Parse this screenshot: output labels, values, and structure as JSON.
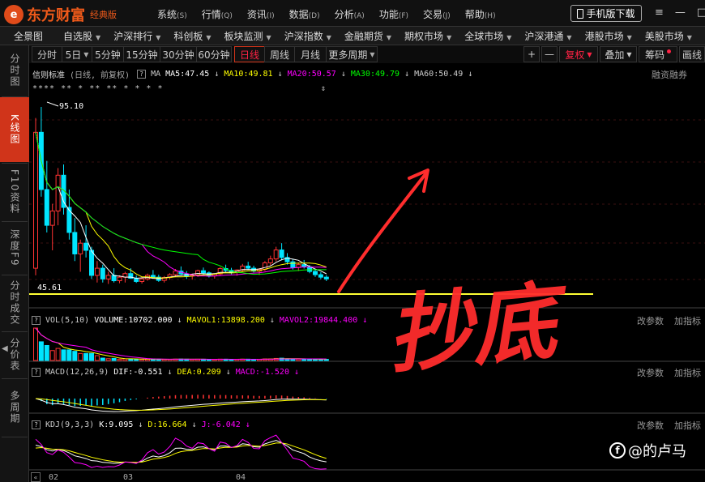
{
  "app": {
    "logo_mark": "e",
    "name": "东方财富",
    "edition": "经典版"
  },
  "main_menu": [
    {
      "label": "系统",
      "key": "S"
    },
    {
      "label": "行情",
      "key": "Q"
    },
    {
      "label": "资讯",
      "key": "I"
    },
    {
      "label": "数据",
      "key": "D"
    },
    {
      "label": "分析",
      "key": "A"
    },
    {
      "label": "功能",
      "key": "F"
    },
    {
      "label": "交易",
      "key": "J"
    },
    {
      "label": "帮助",
      "key": "H"
    }
  ],
  "mobile_download": "手机版下载",
  "subnav": [
    "全景图",
    "自选股",
    "沪深排行",
    "科创板",
    "板块监测",
    "沪深指数",
    "金融期货",
    "期权市场",
    "全球市场",
    "沪深港通",
    "港股市场",
    "美股市场"
  ],
  "left_tabs": [
    {
      "label": "分时图",
      "active": false
    },
    {
      "label": "K线图",
      "active": true
    },
    {
      "label": "F10资料",
      "active": false
    },
    {
      "label": "深度F9",
      "active": false
    },
    {
      "label": "分时成交",
      "active": false
    },
    {
      "label": "分价表",
      "active": false
    },
    {
      "label": "多周期",
      "active": false
    }
  ],
  "period_tabs": [
    {
      "label": "分时",
      "active": false,
      "dropdown": false
    },
    {
      "label": "5日",
      "active": false,
      "dropdown": true
    },
    {
      "label": "5分钟",
      "active": false,
      "dropdown": false
    },
    {
      "label": "15分钟",
      "active": false,
      "dropdown": false
    },
    {
      "label": "30分钟",
      "active": false,
      "dropdown": false
    },
    {
      "label": "60分钟",
      "active": false,
      "dropdown": false
    },
    {
      "label": "日线",
      "active": true,
      "dropdown": false
    },
    {
      "label": "周线",
      "active": false,
      "dropdown": false
    },
    {
      "label": "月线",
      "active": false,
      "dropdown": false
    },
    {
      "label": "更多周期",
      "active": false,
      "dropdown": true
    }
  ],
  "toolbar_right": {
    "zoom_in": "+",
    "zoom_out": "—",
    "fuquan": "复权",
    "overlay": "叠加",
    "chip": "筹码",
    "draw": "画线"
  },
  "main_indicator": {
    "name": "信则标准",
    "mode": "(日线, 前复权)",
    "type": "MA",
    "ma5": "MA5:47.45",
    "ma10": "MA10:49.81",
    "ma20": "MA20:50.57",
    "ma30": "MA30:49.79",
    "ma60": "MA60:50.49",
    "right_link": "融资融券",
    "event_markers": "**** ** *  **     ** *  *  *       *",
    "high_label": "95.10",
    "low_label": "45.61",
    "colors": {
      "ma5": "#ffffff",
      "ma10": "#ffff00",
      "ma20": "#ff00ff",
      "ma30": "#00ff00",
      "ma60": "#cccccc",
      "up": "#ff3333",
      "down": "#00e5ff",
      "support_line": "#ffff33"
    }
  },
  "volume_indicator": {
    "name": "VOL(5,10)",
    "volume": "VOLUME:10702.000",
    "mavol1": "MAVOL1:13898.200",
    "mavol2": "MAVOL2:19844.400"
  },
  "macd_indicator": {
    "name": "MACD(12,26,9)",
    "dif": "DIF:-0.551",
    "dea": "DEA:0.209",
    "macd": "MACD:-1.520"
  },
  "kdj_indicator": {
    "name": "KDJ(9,3,3)",
    "k": "K:9.095",
    "d": "D:16.664",
    "j": "J:-6.042"
  },
  "panel_links": {
    "params": "改参数",
    "add_indicator": "加指标"
  },
  "x_axis": [
    "02",
    "03",
    "04"
  ],
  "annotation": {
    "text": "抄底",
    "color": "#ff2d2d"
  },
  "brand": {
    "icon": "f",
    "name": "@的卢马"
  },
  "chart_data": [
    {
      "type": "candlestick",
      "title": "信则标准 (日线, 前复权)",
      "max_label": 95.1,
      "min_label": 45.61,
      "note": "daily K-line: price spikes to 95.10 then trends down, consolidates near 45.61 support",
      "ohlc": [
        [
          50,
          92,
          48,
          88
        ],
        [
          88,
          95.1,
          70,
          72
        ],
        [
          72,
          80,
          60,
          62
        ],
        [
          62,
          68,
          55,
          66
        ],
        [
          66,
          78,
          62,
          76
        ],
        [
          76,
          79,
          65,
          67
        ],
        [
          67,
          72,
          58,
          60
        ],
        [
          60,
          64,
          52,
          54
        ],
        [
          54,
          58,
          49,
          57
        ],
        [
          57,
          62,
          53,
          55
        ],
        [
          55,
          56,
          47,
          48
        ],
        [
          48,
          52,
          46,
          50
        ],
        [
          50,
          51,
          46,
          47
        ],
        [
          47,
          49,
          45.6,
          48
        ],
        [
          48,
          50,
          46,
          46.5
        ],
        [
          46.5,
          48,
          45.8,
          47.5
        ],
        [
          47.5,
          49,
          46,
          48.5
        ],
        [
          48.5,
          50,
          47,
          47.2
        ],
        [
          47.2,
          48,
          45.9,
          46.3
        ],
        [
          46.3,
          47.5,
          45.7,
          47
        ],
        [
          47,
          48.5,
          46.5,
          48
        ],
        [
          48,
          49.5,
          47,
          47.5
        ],
        [
          47.5,
          48.2,
          46.2,
          46.6
        ],
        [
          46.6,
          47.8,
          46,
          47.4
        ],
        [
          47.4,
          48.6,
          46.8,
          48.2
        ],
        [
          48.2,
          49.8,
          47.5,
          49.2
        ],
        [
          49.2,
          50.5,
          48,
          48.4
        ],
        [
          48.4,
          49.2,
          47,
          47.8
        ],
        [
          47.8,
          48.5,
          46.8,
          48.1
        ],
        [
          48.1,
          49.6,
          47.6,
          49.3
        ],
        [
          49.3,
          50.2,
          48.2,
          48.7
        ],
        [
          48.7,
          49.1,
          47.4,
          47.9
        ],
        [
          47.9,
          48.6,
          47.1,
          48.4
        ],
        [
          48.4,
          50.3,
          48,
          49.9
        ],
        [
          49.9,
          51,
          48.9,
          49.4
        ],
        [
          49.4,
          50.1,
          48.3,
          48.8
        ],
        [
          48.8,
          49.7,
          47.9,
          49.5
        ],
        [
          49.5,
          51.2,
          49,
          50.6
        ],
        [
          50.6,
          51.8,
          49.6,
          50
        ],
        [
          50,
          50.7,
          48.8,
          49.2
        ],
        [
          49.2,
          50,
          48.1,
          49.7
        ],
        [
          49.7,
          52,
          49.2,
          51.5
        ],
        [
          51.5,
          53.5,
          50.8,
          52.6
        ],
        [
          52.6,
          56,
          51.9,
          55.1
        ],
        [
          55.1,
          57,
          52.2,
          53
        ],
        [
          53,
          54.2,
          51,
          51.8
        ],
        [
          51.8,
          52.5,
          49.6,
          50.2
        ],
        [
          50.2,
          51.6,
          49.2,
          51
        ],
        [
          51,
          52.3,
          49.9,
          50.4
        ],
        [
          50.4,
          50.9,
          48.6,
          49.1
        ],
        [
          49.1,
          49.8,
          47.6,
          48.2
        ],
        [
          48.2,
          48.9,
          46.9,
          47.5
        ],
        [
          47.5,
          48.1,
          46.4,
          47
        ]
      ]
    },
    {
      "type": "bar",
      "title": "VOL(5,10)",
      "series": [
        {
          "name": "VOLUME",
          "last": 10702.0
        },
        {
          "name": "MAVOL1",
          "last": 13898.2
        },
        {
          "name": "MAVOL2",
          "last": 19844.4
        }
      ]
    },
    {
      "type": "line",
      "title": "MACD(12,26,9)",
      "series": [
        {
          "name": "DIF",
          "last": -0.551
        },
        {
          "name": "DEA",
          "last": 0.209
        },
        {
          "name": "MACD",
          "last": -1.52
        }
      ]
    },
    {
      "type": "line",
      "title": "KDJ(9,3,3)",
      "series": [
        {
          "name": "K",
          "last": 9.095
        },
        {
          "name": "D",
          "last": 16.664
        },
        {
          "name": "J",
          "last": -6.042
        }
      ]
    }
  ]
}
